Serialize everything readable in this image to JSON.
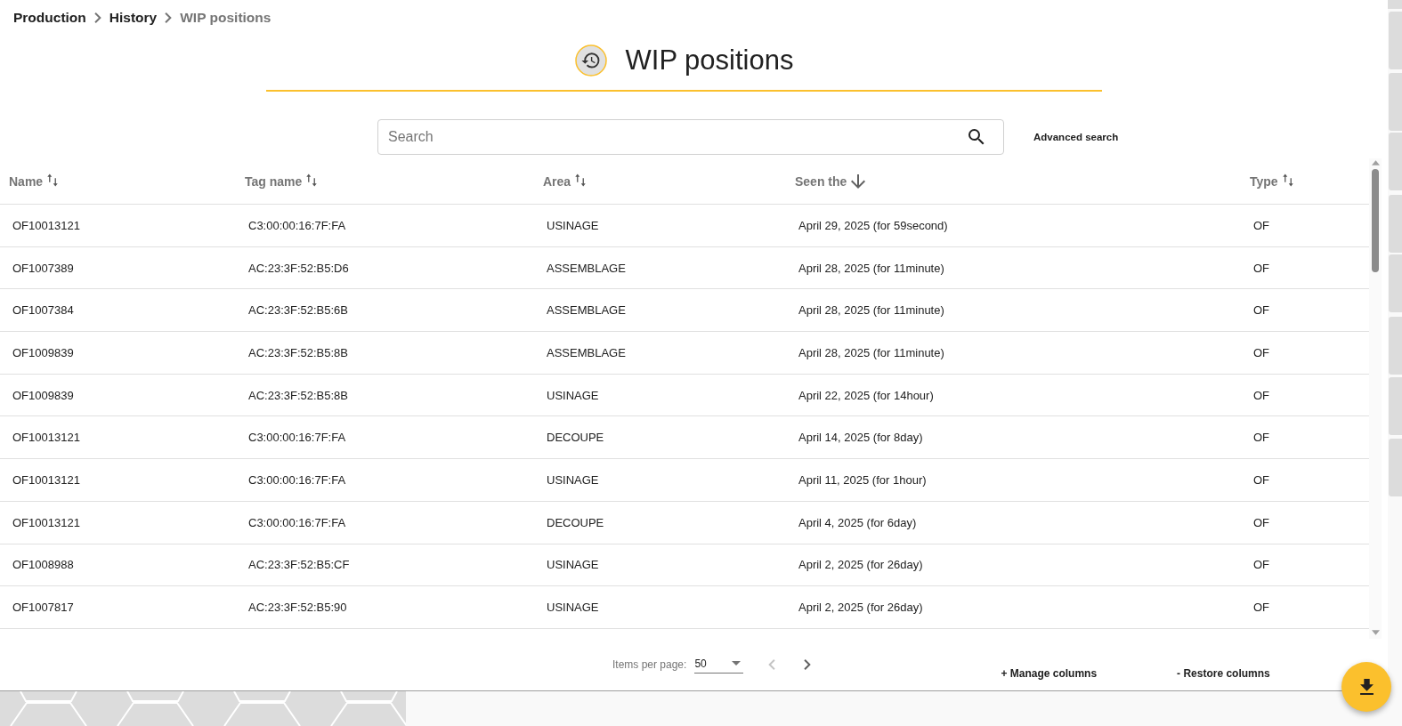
{
  "breadcrumb": [
    {
      "label": "Production",
      "current": false
    },
    {
      "label": "History",
      "current": false
    },
    {
      "label": "WIP positions",
      "current": true
    }
  ],
  "header": {
    "title": "WIP positions"
  },
  "search": {
    "placeholder": "Search",
    "advanced_link": "Advanced search"
  },
  "table": {
    "columns": [
      {
        "label": "Name",
        "sorted": false
      },
      {
        "label": "Tag name",
        "sorted": false
      },
      {
        "label": "Area",
        "sorted": false
      },
      {
        "label": "Seen the",
        "sorted": true
      },
      {
        "label": "Type",
        "sorted": false
      }
    ],
    "rows": [
      [
        "OF10013121",
        "C3:00:00:16:7F:FA",
        "USINAGE",
        "April 29, 2025 (for 59second)",
        "OF"
      ],
      [
        "OF1007389",
        "AC:23:3F:52:B5:D6",
        "ASSEMBLAGE",
        "April 28, 2025 (for 11minute)",
        "OF"
      ],
      [
        "OF1007384",
        "AC:23:3F:52:B5:6B",
        "ASSEMBLAGE",
        "April 28, 2025 (for 11minute)",
        "OF"
      ],
      [
        "OF1009839",
        "AC:23:3F:52:B5:8B",
        "ASSEMBLAGE",
        "April 28, 2025 (for 11minute)",
        "OF"
      ],
      [
        "OF1009839",
        "AC:23:3F:52:B5:8B",
        "USINAGE",
        "April 22, 2025 (for 14hour)",
        "OF"
      ],
      [
        "OF10013121",
        "C3:00:00:16:7F:FA",
        "DECOUPE",
        "April 14, 2025 (for 8day)",
        "OF"
      ],
      [
        "OF10013121",
        "C3:00:00:16:7F:FA",
        "USINAGE",
        "April 11, 2025 (for 1hour)",
        "OF"
      ],
      [
        "OF10013121",
        "C3:00:00:16:7F:FA",
        "DECOUPE",
        "April 4, 2025 (for 6day)",
        "OF"
      ],
      [
        "OF1008988",
        "AC:23:3F:52:B5:CF",
        "USINAGE",
        "April 2, 2025 (for 26day)",
        "OF"
      ],
      [
        "OF1007817",
        "AC:23:3F:52:B5:90",
        "USINAGE",
        "April 2, 2025 (for 26day)",
        "OF"
      ]
    ]
  },
  "paginator": {
    "label": "Items per page:",
    "page_size": "50",
    "previous_disabled": true,
    "next_disabled": false
  },
  "column_actions": [
    "+ Manage columns",
    "- Restore columns"
  ]
}
